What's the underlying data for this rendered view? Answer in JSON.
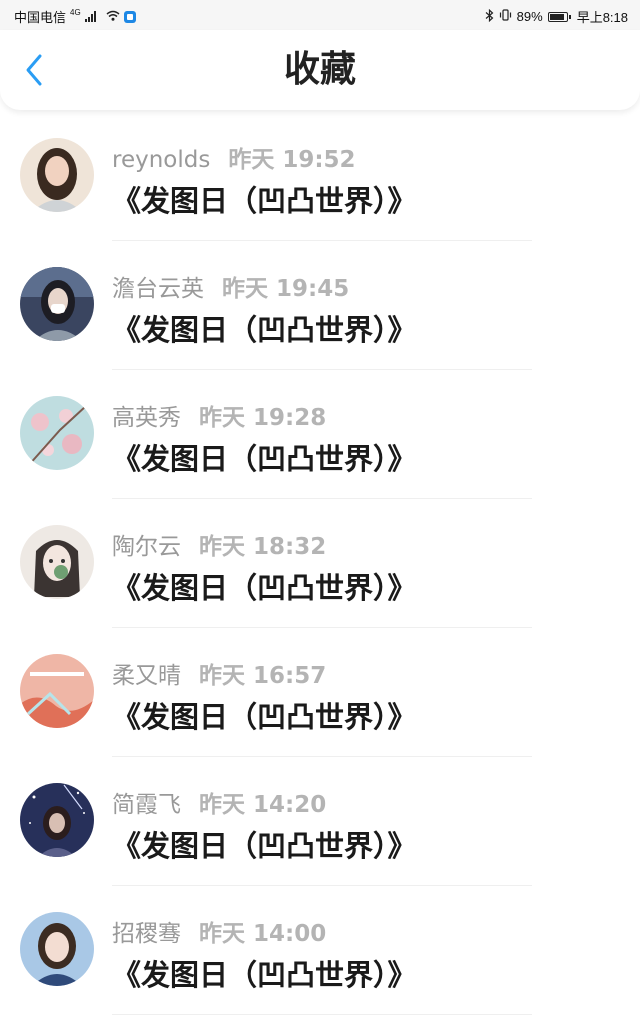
{
  "status_bar": {
    "carrier": "中国电信",
    "network": "4G",
    "battery": "89%",
    "time": "早上8:18"
  },
  "header": {
    "title": "收藏",
    "accent_color": "#2a9df4"
  },
  "items": [
    {
      "name": "reynolds",
      "time": "昨天 19:52",
      "title": "《发图日（凹凸世界）》"
    },
    {
      "name": "澹台云英",
      "time": "昨天 19:45",
      "title": "《发图日（凹凸世界）》"
    },
    {
      "name": "高英秀",
      "time": "昨天 19:28",
      "title": "《发图日（凹凸世界）》"
    },
    {
      "name": "陶尔云",
      "time": "昨天 18:32",
      "title": "《发图日（凹凸世界）》"
    },
    {
      "name": "柔又晴",
      "time": "昨天 16:57",
      "title": "《发图日（凹凸世界）》"
    },
    {
      "name": "简霞飞",
      "time": "昨天 14:20",
      "title": "《发图日（凹凸世界）》"
    },
    {
      "name": "招稷骞",
      "time": "昨天 14:00",
      "title": "《发图日（凹凸世界）》"
    }
  ]
}
